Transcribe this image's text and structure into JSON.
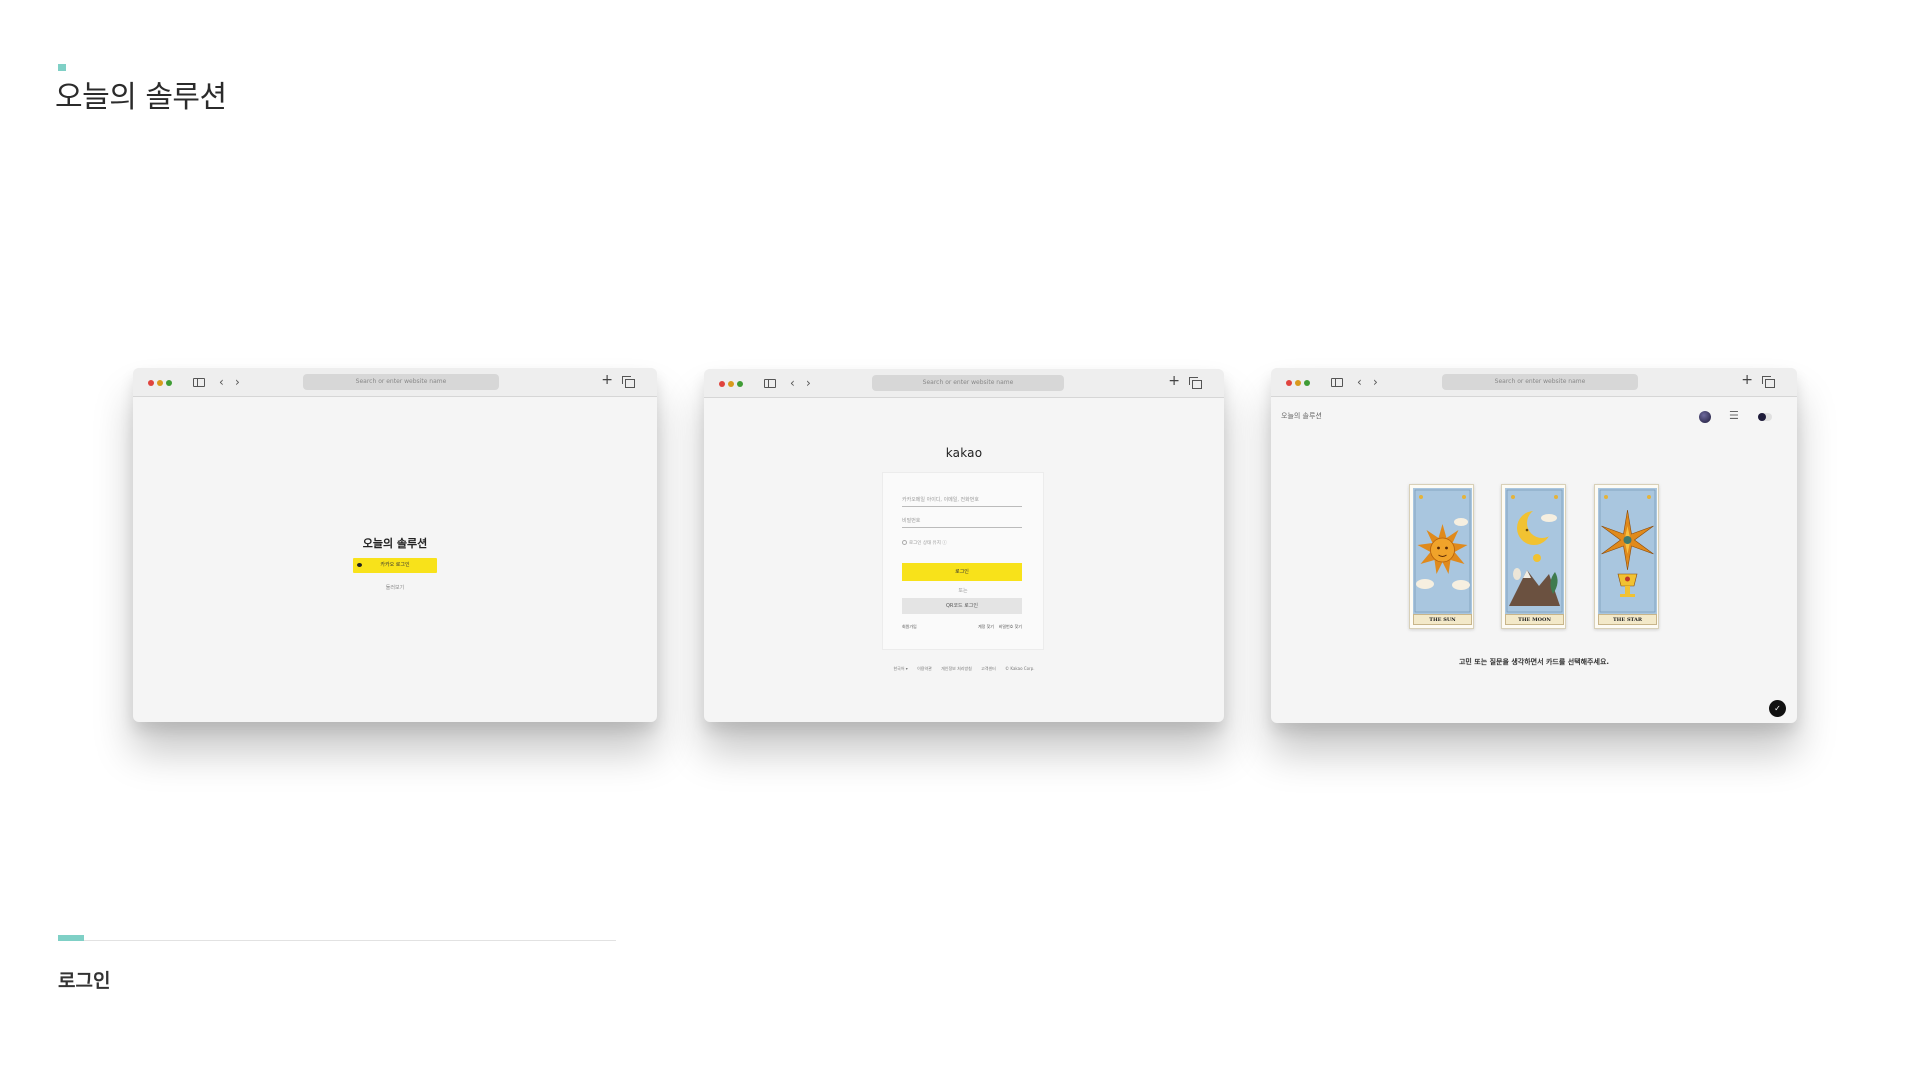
{
  "page": {
    "title": "오늘의 솔루션",
    "section_label": "로그인",
    "accent_color": "#7fd0c6"
  },
  "browser": {
    "url_placeholder": "Search or enter website name",
    "icons": [
      "sidebar-icon",
      "back-icon",
      "forward-icon",
      "plus-icon",
      "tabs-icon"
    ]
  },
  "window_a": {
    "title": "오늘의 솔루션",
    "kakao_button_label": "카카오 로그인",
    "sub_link": "둘러보기",
    "button_color": "#f8e21a"
  },
  "window_b": {
    "logo": "kakao",
    "id_placeholder": "카카오메일 아이디, 이메일, 전화번호",
    "pw_placeholder": "비밀번호",
    "keep_login": "로그인 상태 유지 ⓘ",
    "login_button": "로그인",
    "or_text": "또는",
    "qr_button": "QR코드 로그인",
    "link_signup": "회원가입",
    "link_find_account": "계정 찾기",
    "link_find_pw": "비밀번호 찾기",
    "footer": [
      "한국어 ▾",
      "이용약관",
      "개인정보 처리방침",
      "고객센터",
      "© Kakao Corp."
    ]
  },
  "window_c": {
    "brand": "오늘의 솔루션",
    "menu_icon": "☰",
    "cards": [
      {
        "name": "THE SUN",
        "icon": "sun-icon"
      },
      {
        "name": "THE MOON",
        "icon": "moon-icon"
      },
      {
        "name": "THE STAR",
        "icon": "star-icon"
      }
    ],
    "prompt": "고민 또는 질문을 생각하면서 카드를 선택해주세요.",
    "fab_icon": "✓"
  }
}
